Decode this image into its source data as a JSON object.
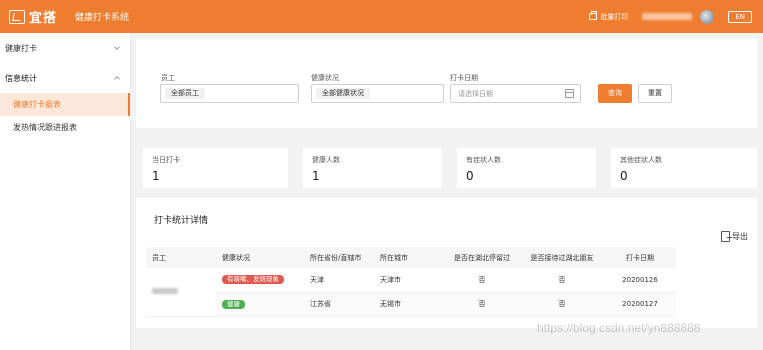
{
  "header": {
    "logo_text": "宜搭",
    "system_name": "健康打卡系统",
    "print_label": "批量打印",
    "lang_label": "EN"
  },
  "sidebar": {
    "groups": [
      {
        "label": "健康打卡",
        "expanded": false
      },
      {
        "label": "信息统计",
        "expanded": true,
        "items": [
          {
            "label": "健康打卡报表",
            "active": true
          },
          {
            "label": "发热情况跟进报表",
            "active": false
          }
        ]
      }
    ]
  },
  "filters": {
    "employee": {
      "label": "员工",
      "value": "全部员工"
    },
    "health": {
      "label": "健康状况",
      "value": "全部健康状况"
    },
    "date": {
      "label": "打卡日期",
      "placeholder": "请选择日期"
    },
    "query_label": "查询",
    "reset_label": "重置"
  },
  "stats": [
    {
      "label": "当日打卡",
      "value": "1"
    },
    {
      "label": "健康人数",
      "value": "1"
    },
    {
      "label": "有症状人数",
      "value": "0"
    },
    {
      "label": "其他症状人数",
      "value": "0"
    }
  ],
  "details": {
    "title": "打卡统计详情",
    "export_label": "导出",
    "columns": [
      "员工",
      "健康状况",
      "所在省份/直辖市",
      "所在城市",
      "是否在湖北停留过",
      "是否接待过湖北朋友",
      "打卡日期"
    ],
    "rows": [
      {
        "status": "有咳嗽、发烧现象",
        "status_color": "#e05a4f",
        "province": "天津",
        "city": "天津市",
        "stayed_hubei": "否",
        "hosted_hubei": "否",
        "date": "20200126"
      },
      {
        "status": "健康",
        "status_color": "#4caf50",
        "province": "江苏省",
        "city": "无锡市",
        "stayed_hubei": "否",
        "hosted_hubei": "否",
        "date": "20200127"
      }
    ]
  },
  "watermark": "https://blog.csdn.net/yn888888",
  "colors": {
    "brand": "#ef7d2f",
    "danger": "#e05a4f",
    "success": "#4caf50"
  }
}
